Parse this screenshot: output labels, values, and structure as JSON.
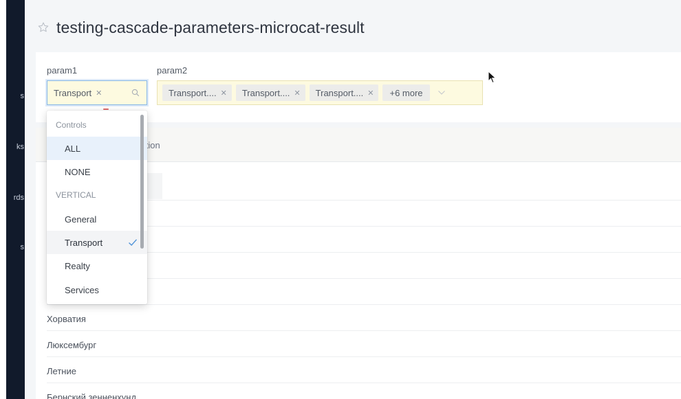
{
  "page": {
    "title": "testing-cascade-parameters-microcat-result"
  },
  "nav": {
    "fragments": [
      "s",
      "ks",
      "rds",
      "s"
    ]
  },
  "params": {
    "param1": {
      "label": "param1",
      "tags": [
        {
          "text": "Transport"
        }
      ]
    },
    "param2": {
      "label": "param2",
      "tags": [
        {
          "text": "Transport...."
        },
        {
          "text": "Transport...."
        },
        {
          "text": "Transport...."
        }
      ],
      "more": "+6 more"
    }
  },
  "dropdown": {
    "items": [
      {
        "kind": "group",
        "text": "Controls"
      },
      {
        "kind": "option",
        "text": "ALL",
        "state": "active"
      },
      {
        "kind": "option",
        "text": "NONE"
      },
      {
        "kind": "group",
        "text": "VERTICAL"
      },
      {
        "kind": "option",
        "text": "General"
      },
      {
        "kind": "option",
        "text": "Transport",
        "state": "selected"
      },
      {
        "kind": "option",
        "text": "Realty"
      },
      {
        "kind": "option",
        "text": "Services"
      }
    ]
  },
  "table": {
    "column_fragment": "alization",
    "rows": [
      "Хорватия",
      "Люксембург",
      "Летние",
      "Бернский зенненхунд"
    ]
  },
  "colors": {
    "nav_bg": "#111a2b",
    "accent_check": "#4f93d8",
    "select_bg": "#fdfae0"
  },
  "icons": {
    "title": "star-icon",
    "search": "search-icon",
    "caret": "chevron-down-icon",
    "check": "check-icon",
    "remove": "close-icon"
  }
}
